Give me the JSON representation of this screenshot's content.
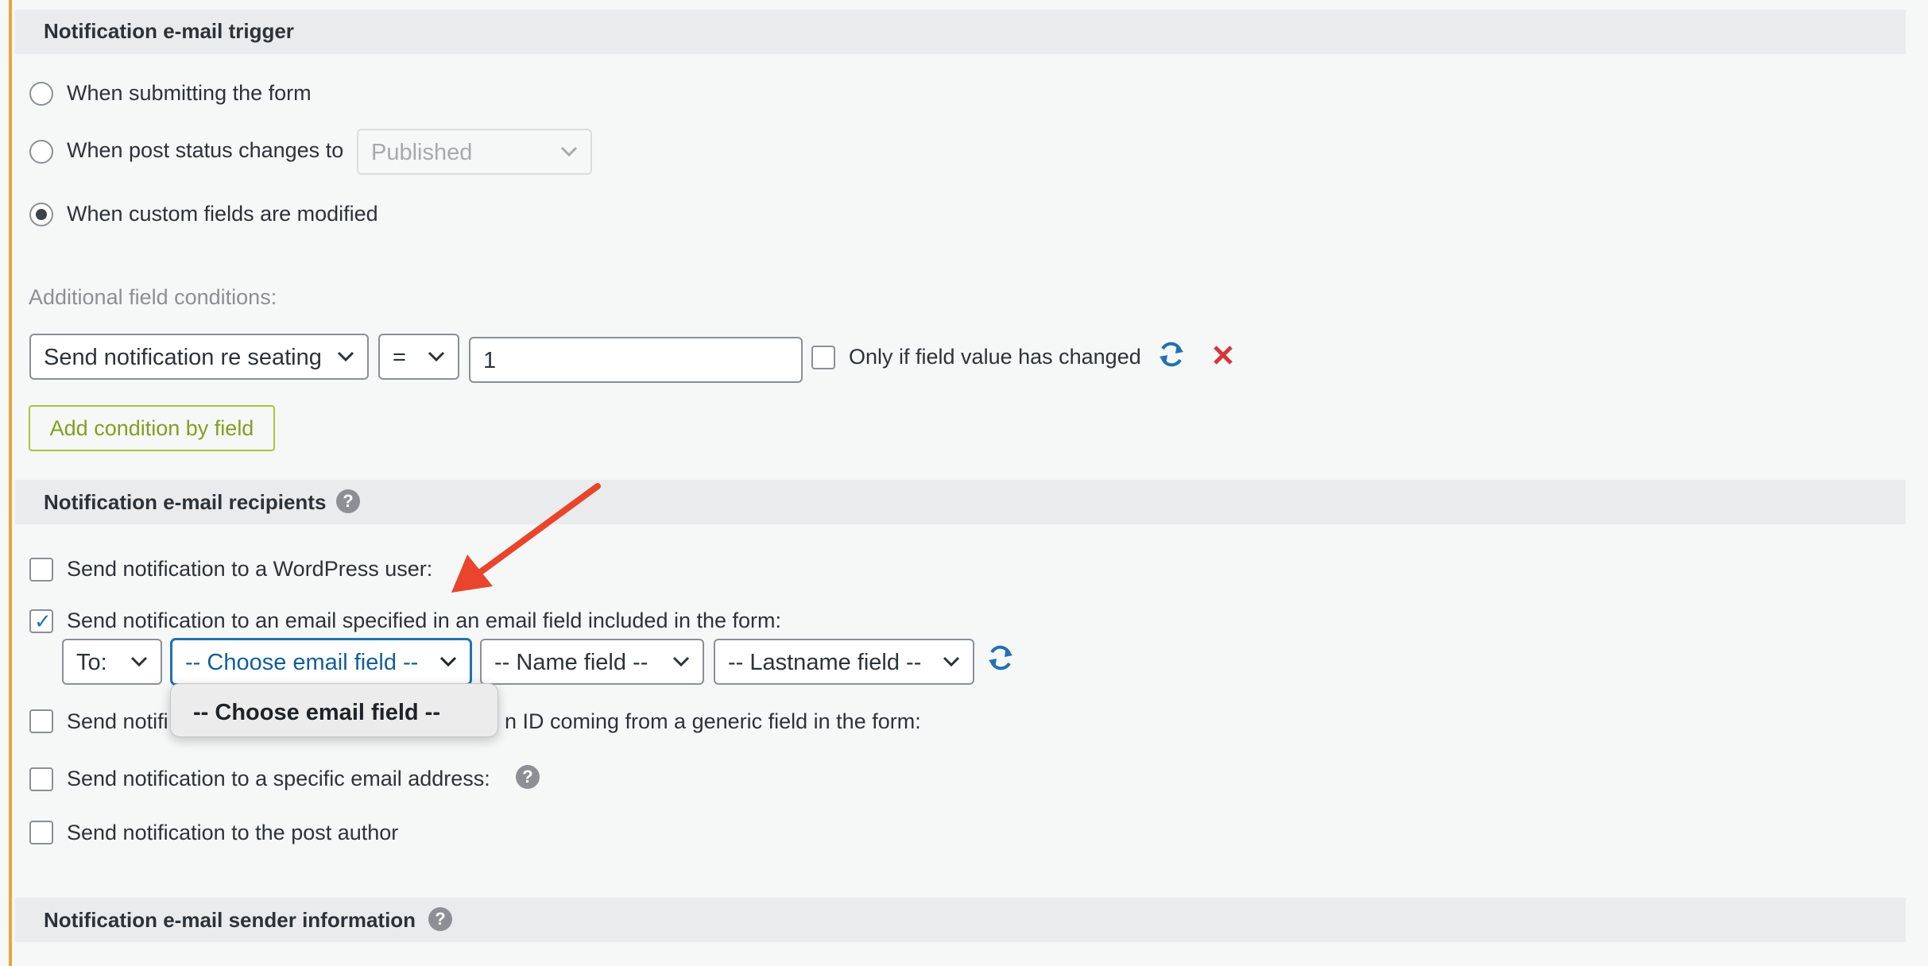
{
  "trigger": {
    "title": "Notification e-mail trigger",
    "options": [
      {
        "label": "When submitting the form",
        "checked": false
      },
      {
        "label": "When post status changes to",
        "checked": false
      },
      {
        "label": "When custom fields are modified",
        "checked": true
      }
    ],
    "post_status_select": "Published",
    "conditions_label": "Additional field conditions:",
    "condition": {
      "field": "Send notification re seating",
      "operator": "=",
      "value": "1",
      "only_changed_label": "Only if field value has changed"
    },
    "add_condition_button": "Add condition by field"
  },
  "recipients": {
    "title": "Notification e-mail recipients",
    "items": [
      {
        "label": "Send notification to a WordPress user:",
        "checked": false
      },
      {
        "label": "Send notification to an email specified in an email field included in the form:",
        "checked": true
      },
      {
        "label_start": "Send notifi",
        "label_end": "n ID coming from a generic field in the form:",
        "checked": false
      },
      {
        "label": "Send notification to a specific email address:",
        "checked": false
      },
      {
        "label": "Send notification to the post author",
        "checked": false
      }
    ],
    "to_select": "To:",
    "email_field_select": "-- Choose email field --",
    "name_field_select": "-- Name field --",
    "lastname_field_select": "-- Lastname field --",
    "dropdown_option": "-- Choose email field --"
  },
  "sender": {
    "title": "Notification e-mail sender information"
  },
  "colors": {
    "accent": "#f0a13b",
    "annotation_arrow": "#e8452c",
    "refresh_icon": "#2271b1",
    "remove_icon": "#d63638"
  }
}
